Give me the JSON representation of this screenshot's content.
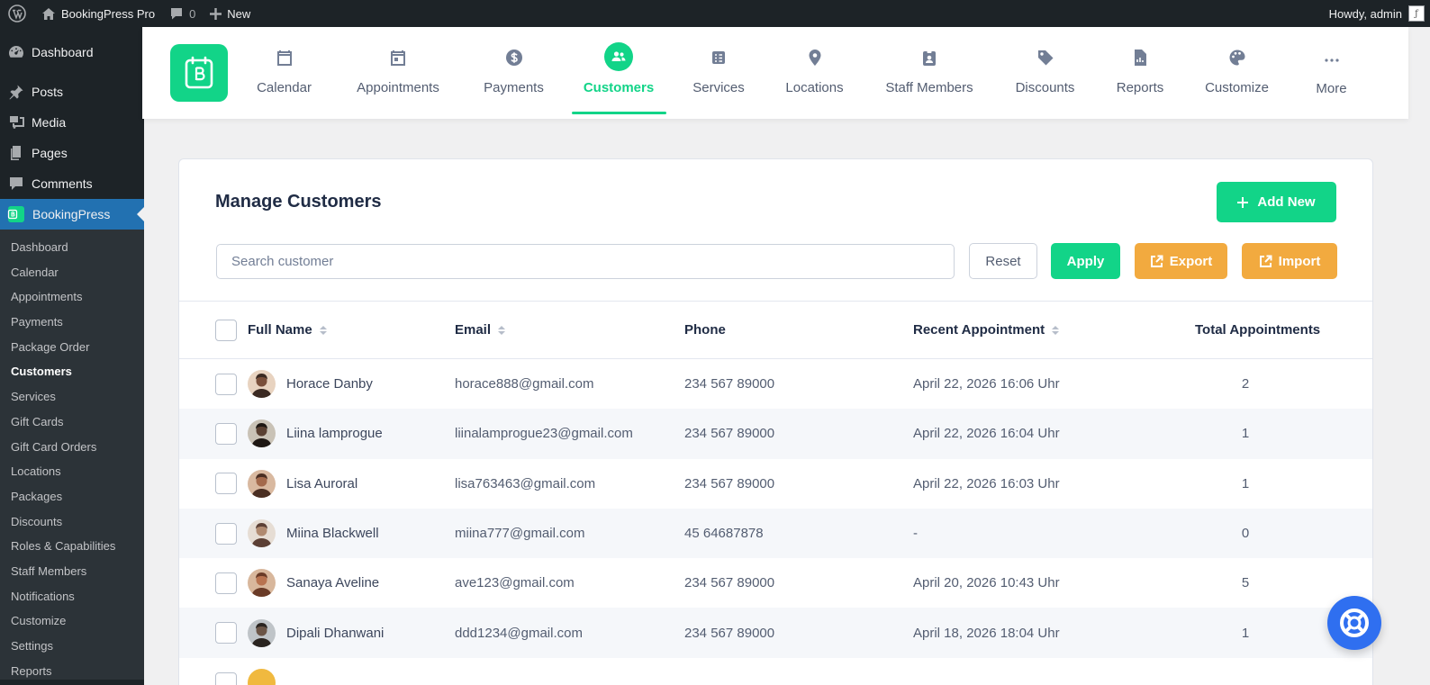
{
  "admin_bar": {
    "site_name": "BookingPress Pro",
    "comments_count": "0",
    "new_label": "New",
    "greeting": "Howdy, admin"
  },
  "sidebar": {
    "top_items": [
      {
        "label": "Dashboard",
        "icon": "dashboard-icon"
      },
      {
        "label": "Posts",
        "icon": "pin-icon"
      },
      {
        "label": "Media",
        "icon": "media-icon"
      },
      {
        "label": "Pages",
        "icon": "pages-icon"
      },
      {
        "label": "Comments",
        "icon": "comment-icon"
      },
      {
        "label": "BookingPress",
        "icon": "bookingpress-icon"
      }
    ],
    "submenu": [
      "Dashboard",
      "Calendar",
      "Appointments",
      "Payments",
      "Package Order",
      "Customers",
      "Services",
      "Gift Cards",
      "Gift Card Orders",
      "Locations",
      "Packages",
      "Discounts",
      "Roles & Capabilities",
      "Staff Members",
      "Notifications",
      "Customize",
      "Settings",
      "Reports"
    ],
    "current_submenu": "Customers"
  },
  "topnav": {
    "tabs": [
      {
        "label": "Calendar",
        "icon": "calendar-icon"
      },
      {
        "label": "Appointments",
        "icon": "calendar-day-icon"
      },
      {
        "label": "Payments",
        "icon": "dollar-circle-icon"
      },
      {
        "label": "Customers",
        "icon": "users-icon",
        "active": true
      },
      {
        "label": "Services",
        "icon": "services-icon"
      },
      {
        "label": "Locations",
        "icon": "location-pin-icon"
      },
      {
        "label": "Staff Members",
        "icon": "staff-badge-icon"
      },
      {
        "label": "Discounts",
        "icon": "tag-icon"
      },
      {
        "label": "Reports",
        "icon": "report-icon"
      },
      {
        "label": "Customize",
        "icon": "palette-icon"
      },
      {
        "label": "More",
        "icon": "more-dots-icon"
      }
    ]
  },
  "page": {
    "title": "Manage Customers",
    "add_new_label": "Add New",
    "search_placeholder": "Search customer",
    "search_value": "",
    "reset_label": "Reset",
    "apply_label": "Apply",
    "export_label": "Export",
    "import_label": "Import"
  },
  "table": {
    "columns": {
      "full_name": "Full Name",
      "email": "Email",
      "phone": "Phone",
      "recent": "Recent Appointment",
      "total": "Total Appointments"
    },
    "rows": [
      {
        "name": "Horace Danby",
        "email": "horace888@gmail.com",
        "phone": "234 567 89000",
        "recent": "April 22, 2026 16:06 Uhr",
        "total": "2"
      },
      {
        "name": "Liina lamprogue",
        "email": "liinalamprogue23@gmail.com",
        "phone": "234 567 89000",
        "recent": "April 22, 2026 16:04 Uhr",
        "total": "1"
      },
      {
        "name": "Lisa Auroral",
        "email": "lisa763463@gmail.com",
        "phone": "234 567 89000",
        "recent": "April 22, 2026 16:03 Uhr",
        "total": "1"
      },
      {
        "name": "Miina Blackwell",
        "email": "miina777@gmail.com",
        "phone": "45 64687878",
        "recent": "-",
        "total": "0"
      },
      {
        "name": "Sanaya Aveline",
        "email": "ave123@gmail.com",
        "phone": "234 567 89000",
        "recent": "April 20, 2026 10:43 Uhr",
        "total": "5"
      },
      {
        "name": "Dipali Dhanwani",
        "email": "ddd1234@gmail.com",
        "phone": "234 567 89000",
        "recent": "April 18, 2026 18:04 Uhr",
        "total": "1"
      }
    ]
  },
  "colors": {
    "brand_green": "#12d488",
    "warning_orange": "#f2aa3f",
    "wp_dark": "#1d2327",
    "wp_blue": "#2271b1",
    "help_blue": "#2f6ff0"
  }
}
